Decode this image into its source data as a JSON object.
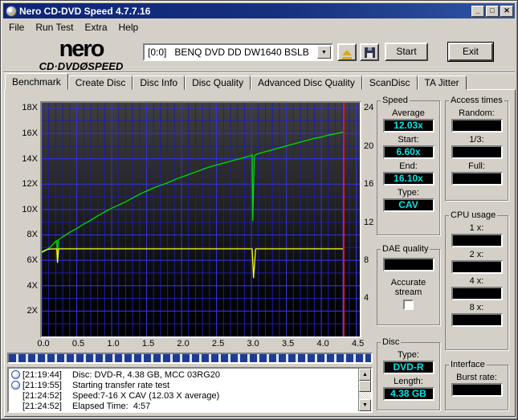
{
  "window": {
    "title": "Nero CD-DVD Speed 4.7.7.16",
    "minimize": "_",
    "maximize": "□",
    "close": "✕"
  },
  "menu": {
    "items": [
      "File",
      "Run Test",
      "Extra",
      "Help"
    ]
  },
  "toolbar": {
    "logo_line1": "nero",
    "logo_line2": "CD·DVDØSPEED",
    "drive_select": "[0:0]   BENQ DVD DD DW1640 BSLB",
    "start_label": "Start",
    "exit_label": "Exit"
  },
  "tabs": [
    {
      "label": "Benchmark",
      "active": true
    },
    {
      "label": "Create Disc",
      "active": false
    },
    {
      "label": "Disc Info",
      "active": false
    },
    {
      "label": "Disc Quality",
      "active": false
    },
    {
      "label": "Advanced Disc Quality",
      "active": false
    },
    {
      "label": "ScanDisc",
      "active": false
    },
    {
      "label": "TA Jitter",
      "active": false
    }
  ],
  "chart_data": {
    "type": "line",
    "xlim": [
      0,
      4.55
    ],
    "ylim": [
      0,
      18.4
    ],
    "x_tick_values": [
      0,
      0.5,
      1,
      1.5,
      2,
      2.5,
      3,
      3.5,
      4,
      4.5
    ],
    "x_ticks": [
      "0.0",
      "0.5",
      "1.0",
      "1.5",
      "2.0",
      "2.5",
      "3.0",
      "3.5",
      "4.0",
      "4.5"
    ],
    "y_left_tick_values": [
      18,
      16,
      14,
      12,
      10,
      8,
      6,
      4,
      2
    ],
    "y_left_ticks": [
      "18X",
      "16X",
      "14X",
      "12X",
      "10X",
      "8X",
      "6X",
      "4X",
      "2X"
    ],
    "y_right_ticks": [
      "24",
      "20",
      "16",
      "12",
      "8",
      "4"
    ],
    "grid": {
      "minor_x": 0.1,
      "major_x": 0.5,
      "minor_y": 1,
      "major_y": 2,
      "on": true
    },
    "end_marker_x": 4.32,
    "series": [
      {
        "name": "read-speed",
        "color": "#00dc00",
        "points": [
          [
            0,
            6.6
          ],
          [
            0.05,
            6.75
          ],
          [
            0.1,
            6.95
          ],
          [
            0.15,
            7.2
          ],
          [
            0.2,
            7.5
          ],
          [
            0.215,
            7.55
          ],
          [
            0.225,
            5.9
          ],
          [
            0.235,
            7.6
          ],
          [
            0.3,
            7.85
          ],
          [
            0.4,
            8.2
          ],
          [
            0.5,
            8.5
          ],
          [
            0.6,
            8.85
          ],
          [
            0.7,
            9.15
          ],
          [
            0.8,
            9.5
          ],
          [
            0.9,
            9.8
          ],
          [
            1,
            10.1
          ],
          [
            1.1,
            10.35
          ],
          [
            1.2,
            10.6
          ],
          [
            1.3,
            10.9
          ],
          [
            1.4,
            11.2
          ],
          [
            1.5,
            11.45
          ],
          [
            1.6,
            11.7
          ],
          [
            1.7,
            11.9
          ],
          [
            1.8,
            12.1
          ],
          [
            1.9,
            12.35
          ],
          [
            2,
            12.55
          ],
          [
            2.1,
            12.75
          ],
          [
            2.2,
            12.95
          ],
          [
            2.3,
            13.15
          ],
          [
            2.4,
            13.35
          ],
          [
            2.5,
            13.5
          ],
          [
            2.6,
            13.65
          ],
          [
            2.7,
            13.8
          ],
          [
            2.8,
            13.95
          ],
          [
            2.9,
            14.1
          ],
          [
            3,
            14.25
          ],
          [
            3.01,
            14.3
          ],
          [
            3.02,
            9.1
          ],
          [
            3.04,
            14.2
          ],
          [
            3.06,
            14.3
          ],
          [
            3.1,
            14.4
          ],
          [
            3.2,
            14.55
          ],
          [
            3.3,
            14.7
          ],
          [
            3.4,
            14.85
          ],
          [
            3.5,
            15
          ],
          [
            3.6,
            15.15
          ],
          [
            3.7,
            15.3
          ],
          [
            3.8,
            15.45
          ],
          [
            3.9,
            15.6
          ],
          [
            4,
            15.7
          ],
          [
            4.1,
            15.85
          ],
          [
            4.2,
            15.95
          ],
          [
            4.3,
            16.08
          ],
          [
            4.32,
            16.1
          ]
        ]
      },
      {
        "name": "rotation-speed",
        "color": "#ffff00",
        "points": [
          [
            0,
            6.65
          ],
          [
            0.05,
            6.8
          ],
          [
            0.1,
            6.88
          ],
          [
            0.2,
            6.9
          ],
          [
            0.215,
            6.9
          ],
          [
            0.225,
            5.8
          ],
          [
            0.24,
            6.9
          ],
          [
            0.5,
            6.9
          ],
          [
            1,
            6.9
          ],
          [
            1.5,
            6.9
          ],
          [
            2,
            6.9
          ],
          [
            2.5,
            6.9
          ],
          [
            3,
            6.9
          ],
          [
            3.01,
            6.9
          ],
          [
            3.03,
            4.6
          ],
          [
            3.06,
            6.9
          ],
          [
            3.5,
            6.9
          ],
          [
            4,
            6.9
          ],
          [
            4.32,
            6.9
          ]
        ]
      }
    ]
  },
  "panels": {
    "speed": {
      "title": "Speed",
      "average_label": "Average",
      "average": "12.03x",
      "start_label": "Start:",
      "start": "6.60x",
      "end_label": "End:",
      "end": "16.10x",
      "type_label": "Type:",
      "type": "CAV"
    },
    "access": {
      "title": "Access times",
      "random_label": "Random:",
      "random": "",
      "third_label": "1/3:",
      "third": "",
      "full_label": "Full:",
      "full": ""
    },
    "dae": {
      "title": "DAE quality",
      "quality": "",
      "accurate_line1": "Accurate",
      "accurate_line2": "stream",
      "checked": false
    },
    "cpu": {
      "title": "CPU usage",
      "x1_label": "1 x:",
      "x1": "",
      "x2_label": "2 x:",
      "x2": "",
      "x4_label": "4 x:",
      "x4": "",
      "x8_label": "8 x:",
      "x8": ""
    },
    "disc": {
      "title": "Disc",
      "type_label": "Type:",
      "type": "DVD-R",
      "length_label": "Length:",
      "length": "4.38 GB"
    },
    "interface": {
      "title": "Interface",
      "burst_label": "Burst rate:",
      "burst": ""
    }
  },
  "log": {
    "lines": [
      {
        "time": "[21:19:44]",
        "text": "Disc: DVD-R, 4.38 GB, MCC 03RG20",
        "icon": true
      },
      {
        "time": "[21:19:55]",
        "text": "Starting transfer rate test",
        "icon": true
      },
      {
        "time": "[21:24:52]",
        "text": "Speed:7-16 X CAV (12.03 X average)",
        "icon": false
      },
      {
        "time": "[21:24:52]",
        "text": "Elapsed Time:  4:57",
        "icon": false
      }
    ]
  },
  "colors": {
    "titlebar_blue": "#0e2578",
    "value_cyan": "#00e6e6",
    "grid_minor": "#1d1da8",
    "grid_major": "#3434de",
    "curve_green": "#00dc00",
    "curve_yellow": "#ffff00",
    "marker_red": "#dd1c1c",
    "chrome_gray": "#d4d0c8"
  }
}
